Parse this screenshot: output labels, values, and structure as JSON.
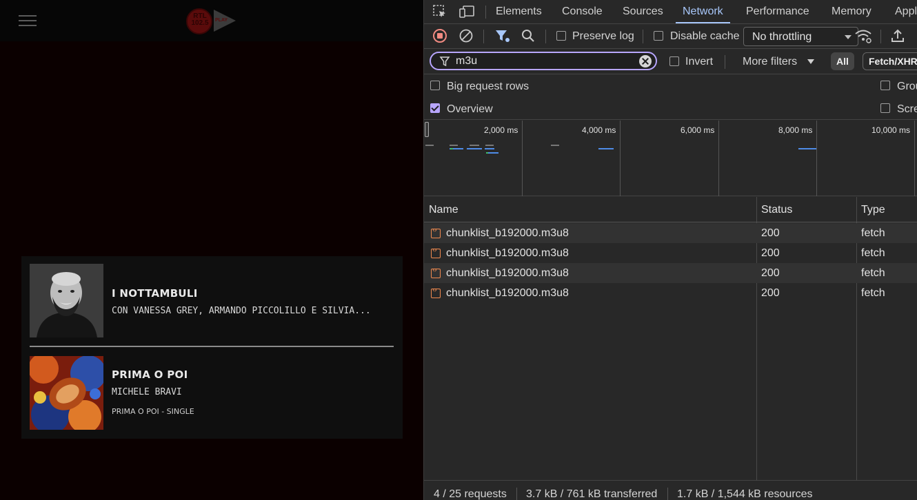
{
  "site": {
    "logo": {
      "disc_text": "RTL 102.5",
      "badge": "PLAY"
    },
    "now_playing": [
      {
        "title": "I NOTTAMBULI",
        "subtitle": "CON VANESSA GREY, ARMANDO PICCOLILLO E SILVIA..."
      },
      {
        "title": "PRIMA O POI",
        "subtitle": "MICHELE BRAVI",
        "album": "PRIMA O POI - SINGLE"
      }
    ]
  },
  "devtools": {
    "tabs": [
      "Elements",
      "Console",
      "Sources",
      "Network",
      "Performance",
      "Memory",
      "Appl"
    ],
    "active_tab": "Network",
    "toolbar": {
      "preserve_log": "Preserve log",
      "disable_cache": "Disable cache",
      "throttling": "No throttling"
    },
    "filter": {
      "value": "m3u",
      "invert": "Invert",
      "more_filters": "More filters",
      "type_all": "All",
      "type_fetch": "Fetch/XHR"
    },
    "options": {
      "big_request_rows": "Big request rows",
      "overview": "Overview",
      "group": "Grou",
      "screenshots": "Scre"
    },
    "overview_ticks": [
      "2,000 ms",
      "4,000 ms",
      "6,000 ms",
      "8,000 ms",
      "10,000 ms"
    ],
    "table": {
      "columns": [
        "Name",
        "Status",
        "Type"
      ],
      "rows": [
        {
          "name": "chunklist_b192000.m3u8",
          "status": "200",
          "type": "fetch"
        },
        {
          "name": "chunklist_b192000.m3u8",
          "status": "200",
          "type": "fetch"
        },
        {
          "name": "chunklist_b192000.m3u8",
          "status": "200",
          "type": "fetch"
        },
        {
          "name": "chunklist_b192000.m3u8",
          "status": "200",
          "type": "fetch"
        }
      ]
    },
    "status_bar": {
      "requests": "4 / 25 requests",
      "transferred": "3.7 kB / 761 kB transferred",
      "resources": "1.7 kB / 1,544 kB resources"
    }
  }
}
